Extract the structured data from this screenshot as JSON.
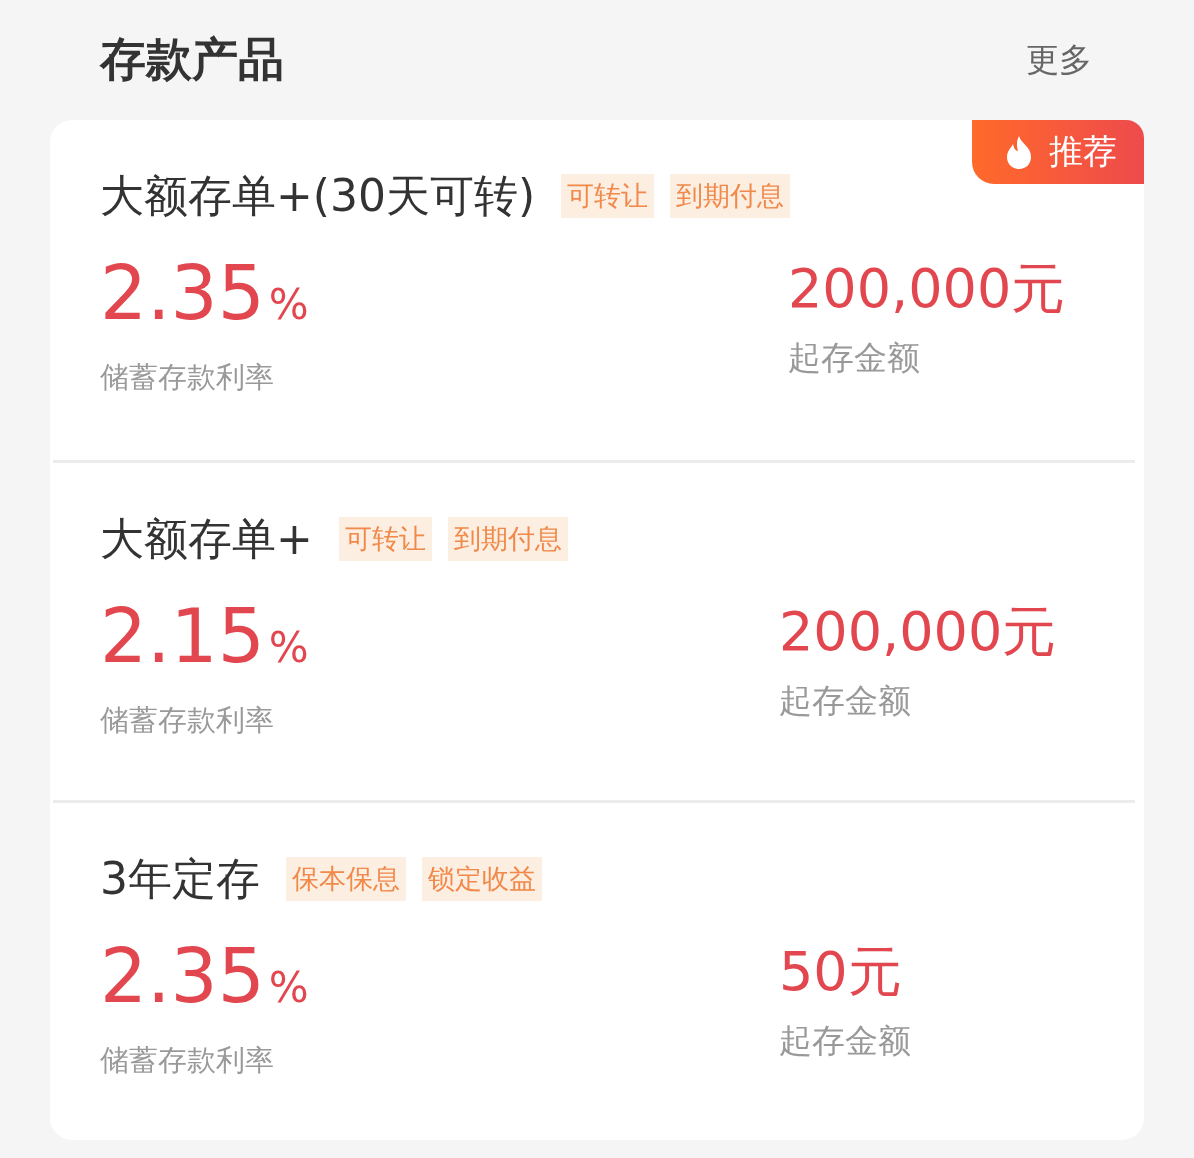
{
  "section": {
    "title": "存款产品",
    "more": "更多"
  },
  "products": [
    {
      "name": "大额存单+(30天可转)",
      "tags": [
        "可转让",
        "到期付息"
      ],
      "rate": "2.35",
      "rate_unit": "%",
      "rate_label": "储蓄存款利率",
      "amount": "200,000元",
      "amount_label": "起存金额",
      "badge": "推荐"
    },
    {
      "name": "大额存单+",
      "tags": [
        "可转让",
        "到期付息"
      ],
      "rate": "2.15",
      "rate_unit": "%",
      "rate_label": "储蓄存款利率",
      "amount": "200,000元",
      "amount_label": "起存金额"
    },
    {
      "name": "3年定存",
      "tags": [
        "保本保息",
        "锁定收益"
      ],
      "rate": "2.35",
      "rate_unit": "%",
      "rate_label": "储蓄存款利率",
      "amount": "50元",
      "amount_label": "起存金额"
    }
  ]
}
